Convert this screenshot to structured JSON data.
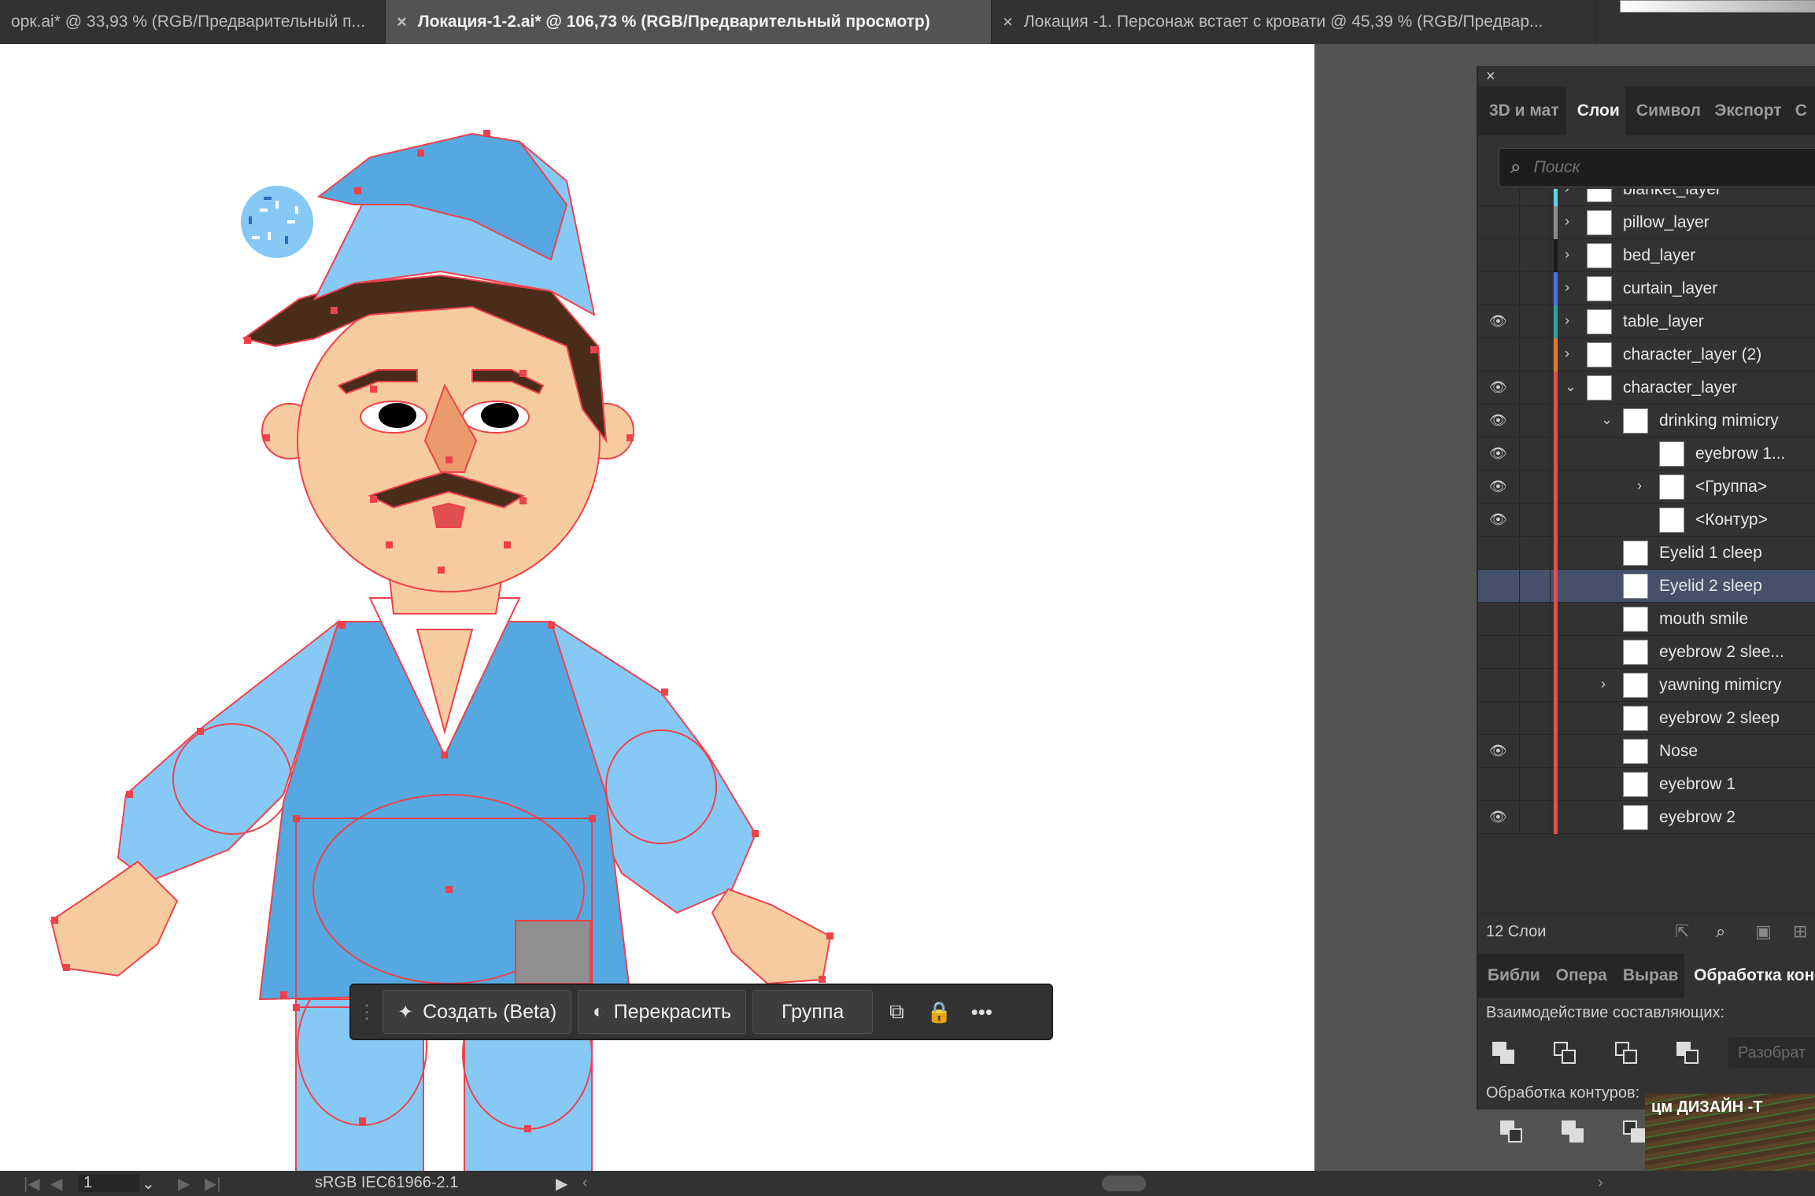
{
  "tabs": [
    {
      "close": "",
      "title": "орк.ai* @ 33,93 % (RGB/Предварительный п..."
    },
    {
      "close": "×",
      "title": "Локация-1-2.ai* @ 106,73 % (RGB/Предварительный просмотр)"
    },
    {
      "close": "×",
      "title": "Локация -1. Персонаж встает с кровати @ 45,39 % (RGB/Предвар..."
    }
  ],
  "layers_panel": {
    "close": "×",
    "tabs": [
      "3D и мат",
      "Слои",
      "Символ",
      "Экспорт",
      "С"
    ],
    "search_placeholder": "Поиск",
    "rows": [
      {
        "name": "blanket_layer",
        "eye": "",
        "chev": "›",
        "color": "#5fd3e6",
        "indent": 0
      },
      {
        "name": "pillow_layer",
        "eye": "",
        "chev": "›",
        "color": "#8a8a8a",
        "indent": 0
      },
      {
        "name": "bed_layer",
        "eye": "",
        "chev": "›",
        "color": "#1a1a1a",
        "indent": 0
      },
      {
        "name": "curtain_layer",
        "eye": "",
        "chev": "›",
        "color": "#4f6fe0",
        "indent": 0
      },
      {
        "name": "table_layer",
        "eye": "👁",
        "chev": "›",
        "color": "#2fa39a",
        "indent": 0
      },
      {
        "name": "character_layer (2)",
        "eye": "",
        "chev": "›",
        "color": "#e07a2a",
        "indent": 0
      },
      {
        "name": "character_layer",
        "eye": "👁",
        "chev": "⌄",
        "color": "#e05050",
        "indent": 0
      },
      {
        "name": "drinking mimicry",
        "eye": "👁",
        "chev": "⌄",
        "color": "#e05050",
        "indent": 1
      },
      {
        "name": "eyebrow 1...",
        "eye": "👁",
        "chev": "",
        "color": "#e05050",
        "indent": 2
      },
      {
        "name": "<Группа>",
        "eye": "👁",
        "chev": "›",
        "color": "#e05050",
        "indent": 2
      },
      {
        "name": "<Контур>",
        "eye": "👁",
        "chev": "",
        "color": "#e05050",
        "indent": 2
      },
      {
        "name": "Eyelid 1 cleep",
        "eye": "",
        "chev": "",
        "color": "#e05050",
        "indent": 1
      },
      {
        "name": "Eyelid 2 sleep",
        "eye": "",
        "chev": "",
        "color": "#e05050",
        "indent": 1,
        "selected": true
      },
      {
        "name": "mouth smile",
        "eye": "",
        "chev": "",
        "color": "#e05050",
        "indent": 1
      },
      {
        "name": "eyebrow 2 slee...",
        "eye": "",
        "chev": "",
        "color": "#e05050",
        "indent": 1
      },
      {
        "name": "yawning mimicry",
        "eye": "",
        "chev": "›",
        "color": "#e05050",
        "indent": 1
      },
      {
        "name": "eyebrow 2 sleep",
        "eye": "",
        "chev": "",
        "color": "#e05050",
        "indent": 1
      },
      {
        "name": "Nose",
        "eye": "👁",
        "chev": "",
        "color": "#e05050",
        "indent": 1
      },
      {
        "name": "eyebrow 1",
        "eye": "",
        "chev": "",
        "color": "#e05050",
        "indent": 1
      },
      {
        "name": "eyebrow 2",
        "eye": "👁",
        "chev": "",
        "color": "#e05050",
        "indent": 1
      }
    ],
    "count": "12 Слои"
  },
  "pathfinder_panel": {
    "tabs": [
      "Библи",
      "Опера",
      "Вырав",
      "Обработка кон"
    ],
    "shape_modes_label": "Взаимодействие составляющих:",
    "expand_label": "Разобрат",
    "pathfinders_label": "Обработка контуров:"
  },
  "context_toolbar": {
    "generate_label": "Создать (Beta)",
    "recolor_label": "Перекрасить",
    "group_label": "Группа"
  },
  "status_bar": {
    "artboard_number": "1",
    "color_profile": "sRGB IEC61966-2.1"
  },
  "background_window": {
    "title": "цм   ДИЗАЙН -Т"
  },
  "colors": {
    "selection": "#f0414b",
    "shirt_light": "#87c9f5",
    "shirt_dark": "#56a8e0",
    "skin": "#f6cba0",
    "hair": "#4a2c1b"
  }
}
